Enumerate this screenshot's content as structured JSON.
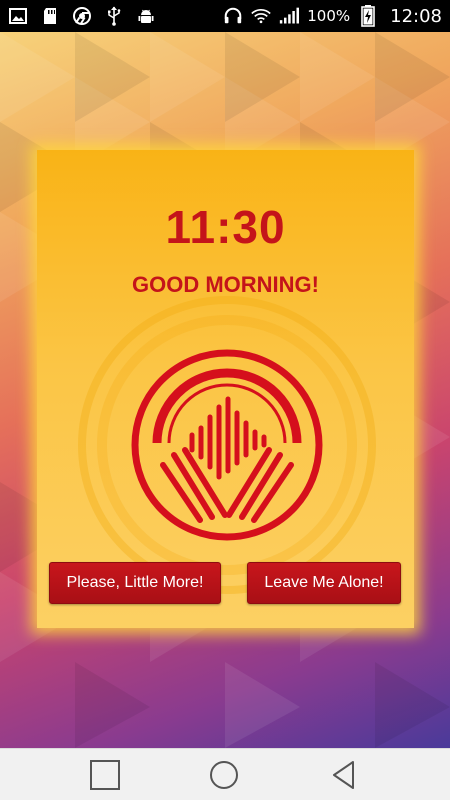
{
  "status_bar": {
    "left_icons": [
      "gallery-icon",
      "sd-card-icon",
      "chrome-icon",
      "usb-icon",
      "android-debug-icon"
    ],
    "right_icons": [
      "headset-icon",
      "wifi-icon",
      "signal-icon",
      "battery-charging-icon"
    ],
    "battery": "100%",
    "time": "12:08"
  },
  "alarm": {
    "time": "11:30",
    "greeting": "GOOD MORNING!",
    "logo_icon": "headphones-soundwave-icon",
    "snooze_label": "Please, Little More!",
    "dismiss_label": "Leave Me Alone!"
  },
  "nav_bar": {
    "icons": [
      "recent-apps-icon",
      "home-icon",
      "back-icon"
    ]
  },
  "colors": {
    "accent_red": "#c4141a",
    "card_yellow": "#f9b316",
    "button_red": "#b3121a"
  }
}
